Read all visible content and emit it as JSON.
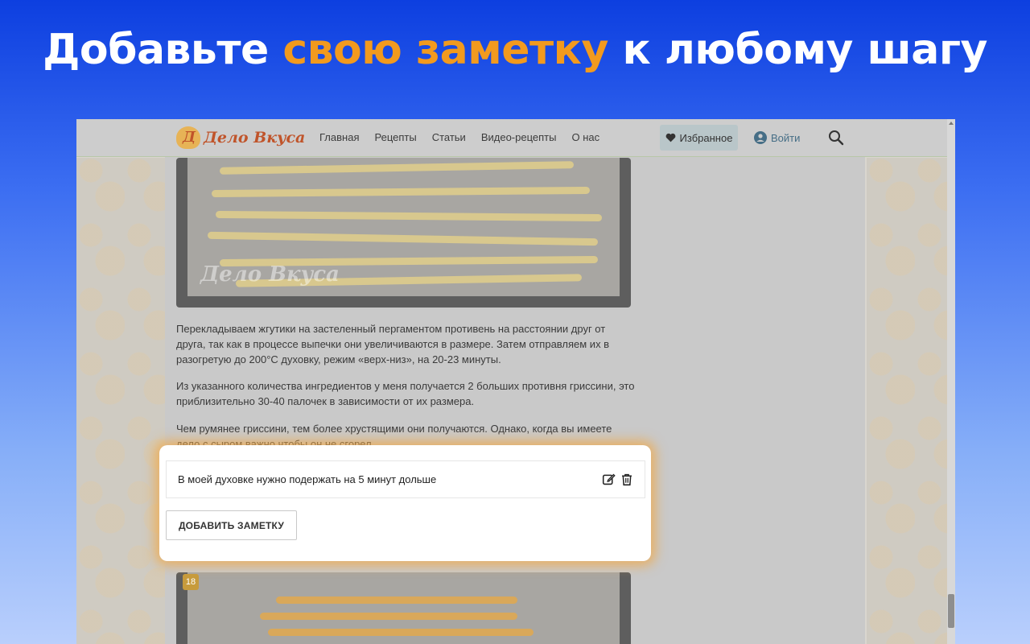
{
  "headline": {
    "part1": "Добавьте ",
    "highlight": "свою заметку",
    "part2": " к любому шагу",
    "highlight_color": "#f29a1e"
  },
  "site": {
    "logo_text": "Дело Вкуса",
    "nav": [
      "Главная",
      "Рецепты",
      "Статьи",
      "Видео-рецепты",
      "О нас"
    ],
    "favorites_label": "Избранное",
    "login_label": "Войти"
  },
  "article": {
    "photo_watermark": "Дело Вкуса",
    "paragraphs": [
      "Перекладываем жгутики на застеленный пергаментом противень на расстоянии друг от друга, так как в процессе выпечки они увеличиваются в размере. Затем отправляем их в разогретую до 200°С духовку, режим «верх-низ», на 20-23 минуты.",
      "Из указанного количества ингредиентов у меня получается 2 больших противня гриссини, это приблизительно 30-40 палочек в зависимости от их размера.",
      "Чем румянее гриссини, тем более хрустящими они получаются. Однако, когда вы имеете дело с сыром важно чтобы он не сгорел."
    ],
    "next_step_number": "18"
  },
  "note_panel": {
    "note_text": "В моей духовке нужно подержать на 5 минут дольше",
    "add_button_label": "ДОБАВИТЬ ЗАМЕТКУ"
  }
}
